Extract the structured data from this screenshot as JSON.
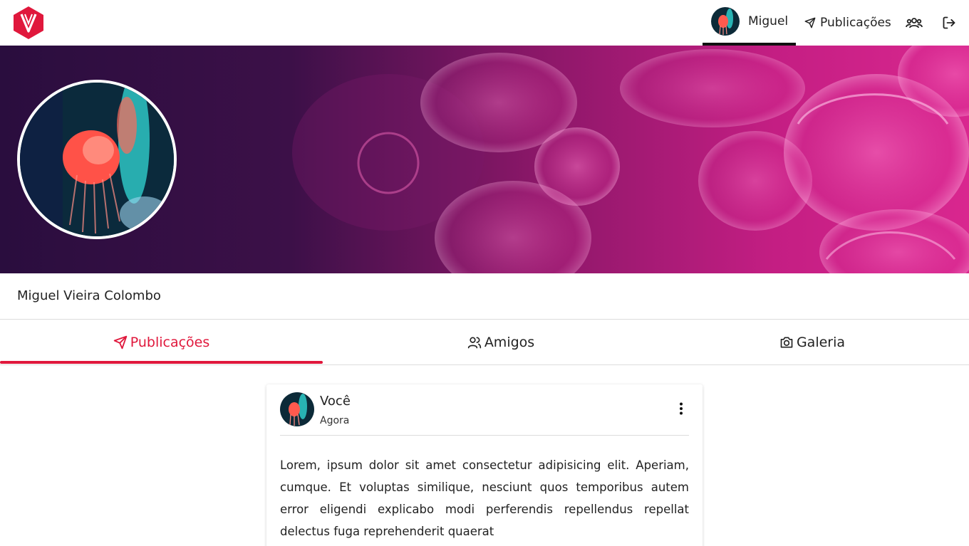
{
  "navbar": {
    "logo_letter": "V",
    "user_name": "Miguel",
    "publications_label": "Publicações",
    "icons": [
      "logo-icon",
      "user-avatar",
      "paper-plane-icon",
      "group-icon",
      "logout-icon"
    ]
  },
  "profile": {
    "full_name": "Miguel Vieira Colombo"
  },
  "tabs": [
    {
      "label": "Publicações",
      "icon": "paper-plane-icon",
      "active": true
    },
    {
      "label": "Amigos",
      "icon": "users-icon",
      "active": false
    },
    {
      "label": "Galeria",
      "icon": "camera-icon",
      "active": false
    }
  ],
  "post": {
    "author": "Você",
    "time": "Agora",
    "body": "Lorem, ipsum dolor sit amet consectetur adipisicing elit. Aperiam, cumque. Et voluptas similique, nesciunt quos temporibus autem error eligendi explicabo modi perferendis repellendus repellat delectus fuga reprehenderit quaerat"
  },
  "colors": {
    "accent": "#e0183c",
    "cover_dark": "#2a0d3e",
    "cover_pink": "#e0268f"
  }
}
